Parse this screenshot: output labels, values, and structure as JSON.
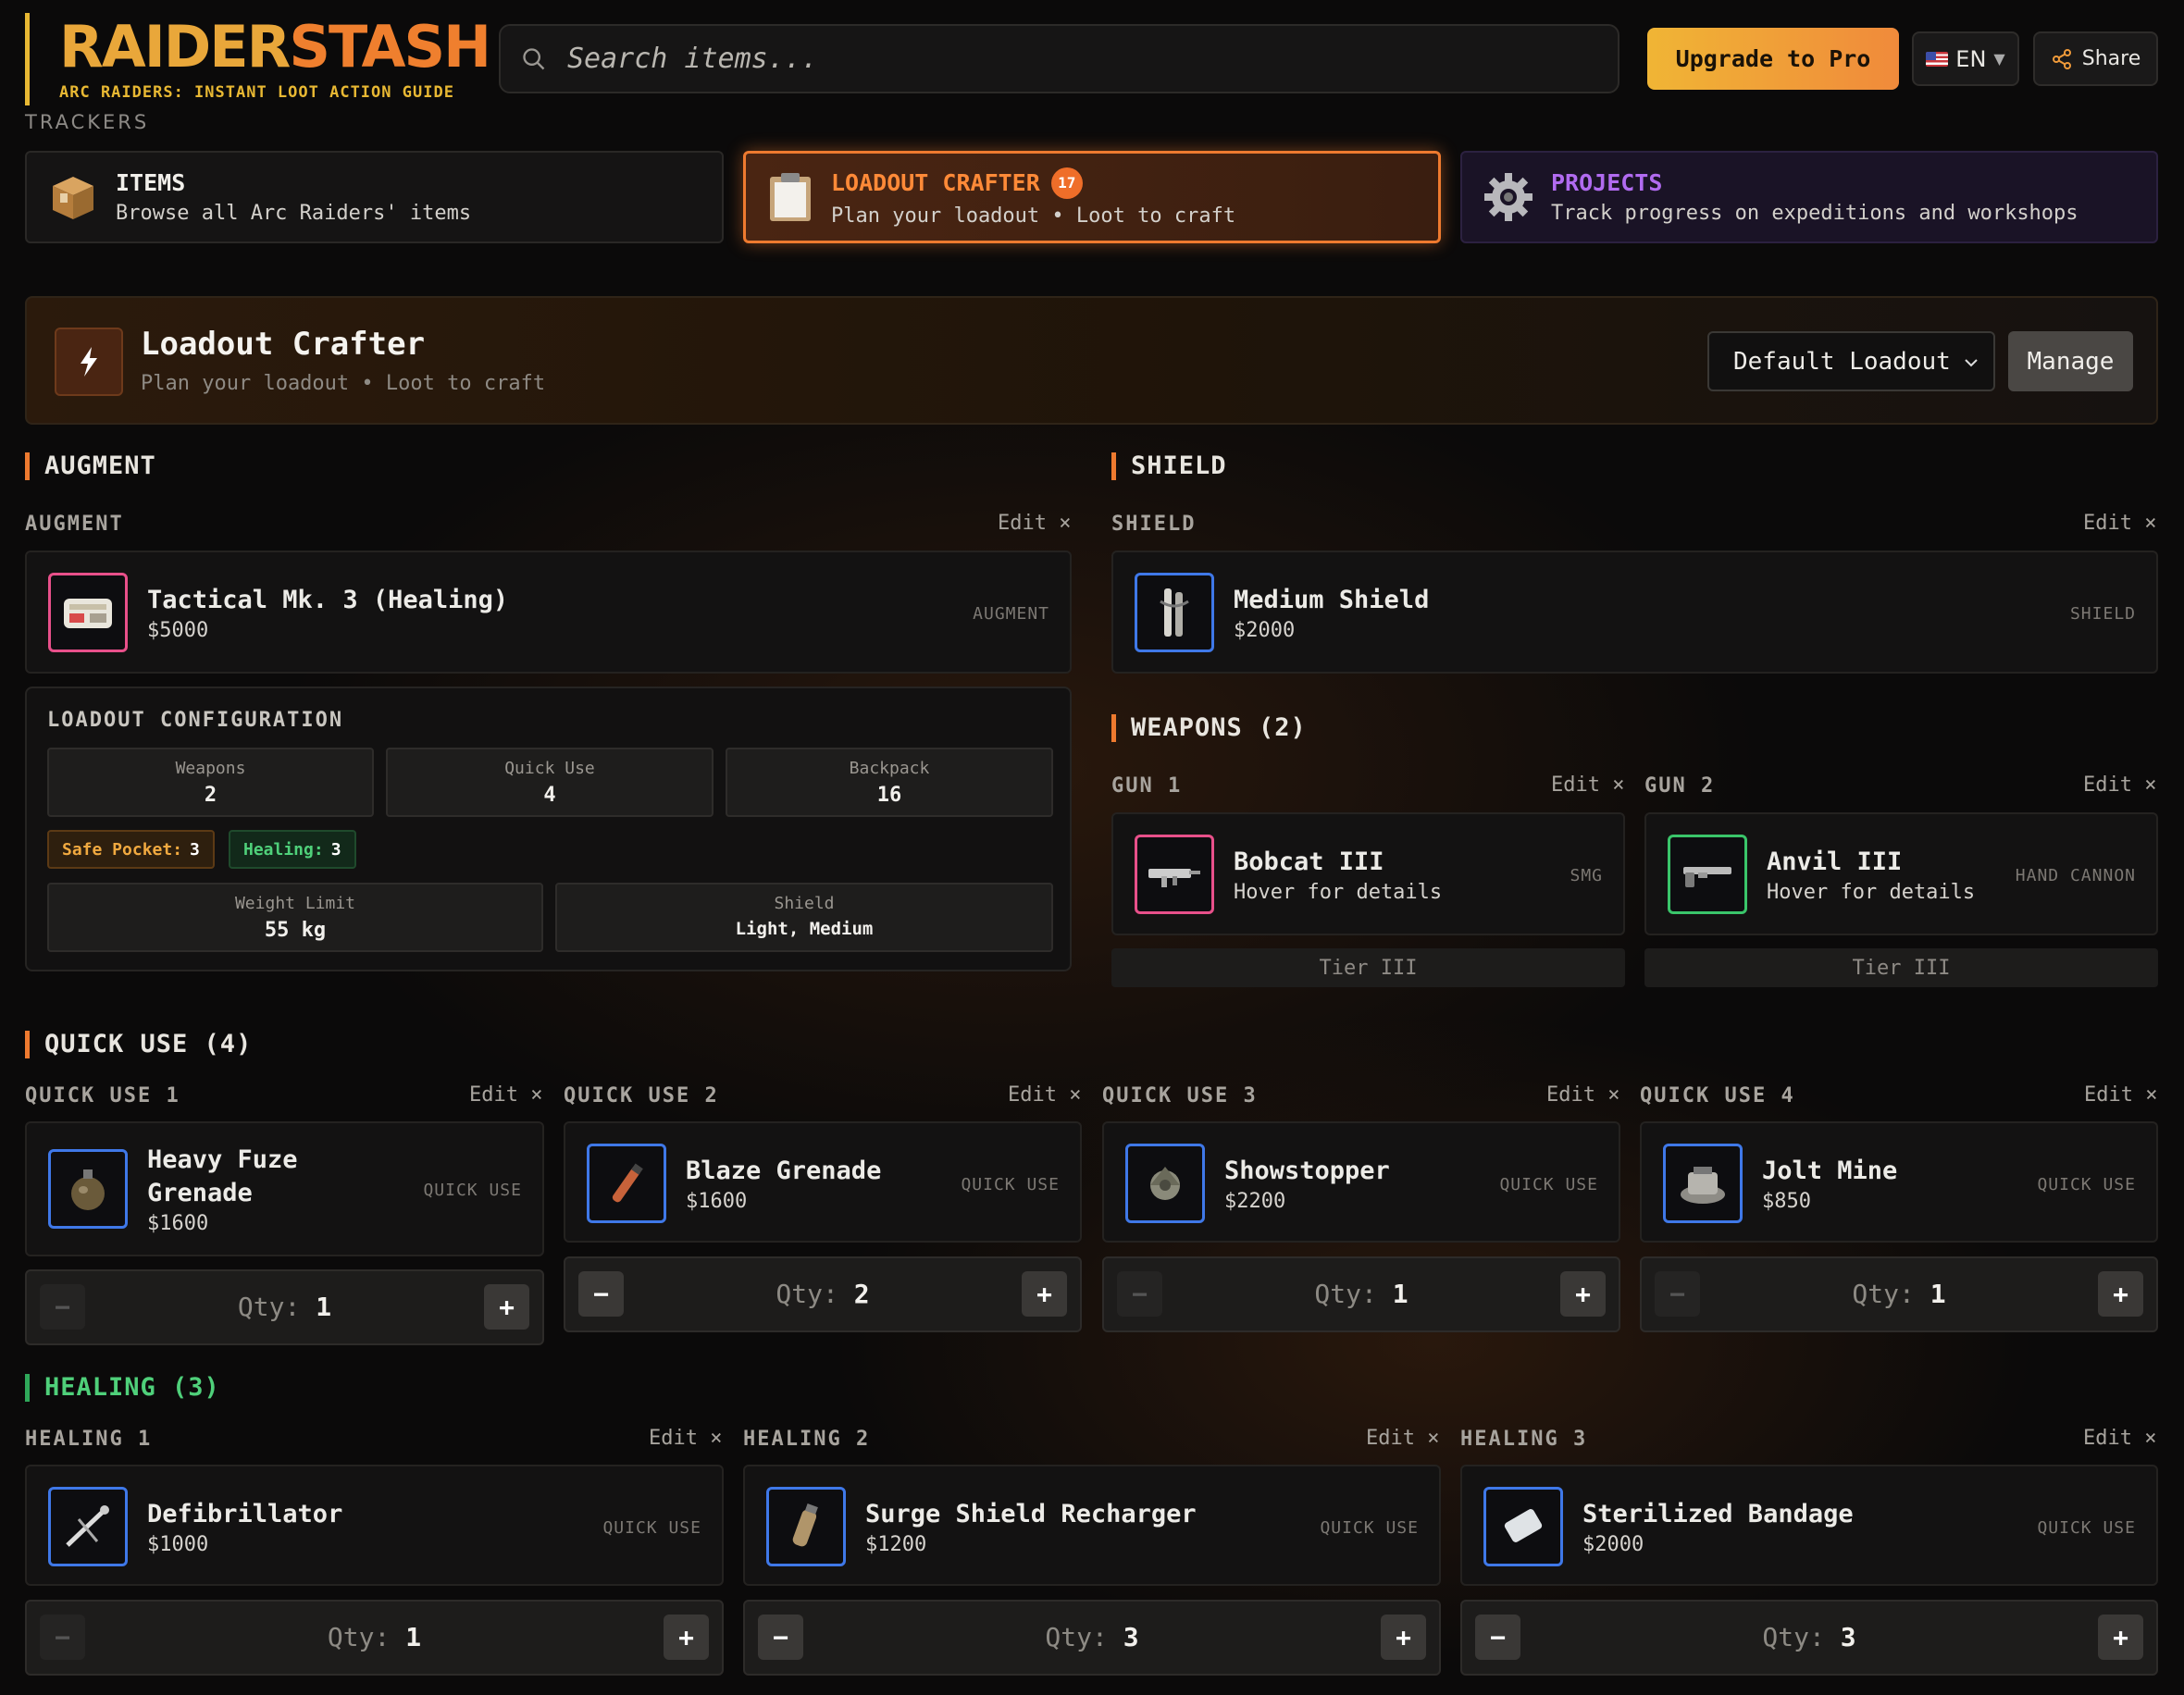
{
  "brand": {
    "name_part1": "RAIDER",
    "name_part2": "STASH",
    "subtitle": "ARC RAIDERS: INSTANT LOOT ACTION GUIDE"
  },
  "search": {
    "placeholder": "Search items..."
  },
  "header": {
    "upgrade_label": "Upgrade to Pro",
    "language": "EN",
    "share_label": "Share"
  },
  "trackers": {
    "label": "TRACKERS",
    "items": [
      {
        "title": "ITEMS",
        "subtitle": "Browse all Arc Raiders' items",
        "icon": "box-icon"
      },
      {
        "title": "LOADOUT CRAFTER",
        "subtitle": "Plan your loadout • Loot to craft",
        "badge": "17",
        "icon": "clipboard-icon",
        "active": true
      },
      {
        "title": "PROJECTS",
        "subtitle": "Track progress on expeditions and workshops",
        "icon": "gear-icon"
      }
    ]
  },
  "crafter": {
    "title": "Loadout Crafter",
    "subtitle": "Plan your loadout • Loot to craft",
    "selected_loadout": "Default Loadout",
    "manage_label": "Manage"
  },
  "common": {
    "edit_label": "Edit",
    "qty_label": "Qty:"
  },
  "augment": {
    "section_title": "AUGMENT",
    "slot_label": "AUGMENT",
    "item": {
      "name": "Tactical Mk. 3 (Healing)",
      "price": "$5000",
      "type": "AUGMENT",
      "border": "pink"
    }
  },
  "shield": {
    "section_title": "SHIELD",
    "slot_label": "SHIELD",
    "item": {
      "name": "Medium Shield",
      "price": "$2000",
      "type": "SHIELD",
      "border": "blue"
    }
  },
  "config": {
    "title": "LOADOUT CONFIGURATION",
    "stats": [
      {
        "label": "Weapons",
        "value": "2"
      },
      {
        "label": "Quick Use",
        "value": "4"
      },
      {
        "label": "Backpack",
        "value": "16"
      }
    ],
    "pills": [
      {
        "label": "Safe Pocket:",
        "value": "3"
      },
      {
        "label": "Healing:",
        "value": "3"
      }
    ],
    "weight": {
      "label": "Weight Limit",
      "value": "55 kg"
    },
    "shield": {
      "label": "Shield",
      "value": "Light, Medium"
    }
  },
  "weapons": {
    "section_title": "WEAPONS (2)",
    "slots": [
      {
        "label": "GUN 1",
        "name": "Bobcat III",
        "detail": "Hover for details",
        "type": "SMG",
        "tier": "Tier III"
      },
      {
        "label": "GUN 2",
        "name": "Anvil III",
        "detail": "Hover for details",
        "type": "HAND CANNON",
        "tier": "Tier III"
      }
    ]
  },
  "quick_use": {
    "section_title": "QUICK USE (4)",
    "slots": [
      {
        "label": "QUICK USE 1",
        "name_line1": "Heavy Fuze",
        "name_line2": "Grenade",
        "price": "$1600",
        "type": "QUICK USE",
        "qty": "1"
      },
      {
        "label": "QUICK USE 2",
        "name": "Blaze Grenade",
        "price": "$1600",
        "type": "QUICK USE",
        "qty": "2"
      },
      {
        "label": "QUICK USE 3",
        "name": "Showstopper",
        "price": "$2200",
        "type": "QUICK USE",
        "qty": "1"
      },
      {
        "label": "QUICK USE 4",
        "name": "Jolt Mine",
        "price": "$850",
        "type": "QUICK USE",
        "qty": "1"
      }
    ]
  },
  "healing": {
    "section_title": "HEALING (3)",
    "slots": [
      {
        "label": "HEALING 1",
        "name": "Defibrillator",
        "price": "$1000",
        "type": "QUICK USE",
        "qty": "1"
      },
      {
        "label": "HEALING 2",
        "name": "Surge Shield Recharger",
        "price": "$1200",
        "type": "QUICK USE",
        "qty": "3"
      },
      {
        "label": "HEALING 3",
        "name": "Sterilized Bandage",
        "price": "$2000",
        "type": "QUICK USE",
        "qty": "3"
      }
    ]
  },
  "colors": {
    "accent_orange": "#ee7a2f",
    "brand_yellow": "#e8b833",
    "projects_purple": "#b16bf0",
    "healing_green": "#4fd07a"
  }
}
